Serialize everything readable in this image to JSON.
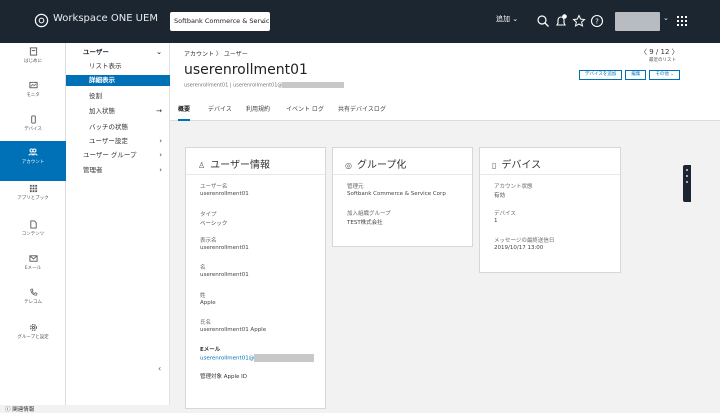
{
  "topbar": {
    "brand": "Workspace ONE UEM",
    "org_selector": "Softbank Commerce & Servic...",
    "add_label": "追加 ⌄"
  },
  "rail": {
    "items": [
      {
        "label": "はじめに",
        "icon": "home-icon"
      },
      {
        "label": "モニタ",
        "icon": "monitor-icon"
      },
      {
        "label": "デバイス",
        "icon": "device-icon"
      },
      {
        "label": "アカウント",
        "icon": "accounts-icon"
      },
      {
        "label": "アプリとブック",
        "icon": "apps-grid-icon"
      },
      {
        "label": "コンテンツ",
        "icon": "content-icon"
      },
      {
        "label": "Eメール",
        "icon": "email-icon"
      },
      {
        "label": "テレコム",
        "icon": "telecom-icon"
      },
      {
        "label": "グループと設定",
        "icon": "gear-icon"
      }
    ],
    "bottom": "関連情報"
  },
  "subnav": {
    "users_head": "ユーザー",
    "list_view": "リスト表示",
    "detail_view": "詳細表示",
    "roles": "役割",
    "enrollment_status": "加入状態",
    "batch_status": "バッチの状態",
    "user_settings": "ユーザー設定",
    "user_groups": "ユーザー グループ",
    "admins": "管理者"
  },
  "header": {
    "breadcrumb": "アカウント  〉 ユーザー",
    "title": "userenrollment01",
    "subtitle": "userenrollment01 | userenrollment01@",
    "pager": "〈   9 / 12   〉",
    "pager_sub": "最近のリスト",
    "btn_add_device": "デバイスを追加",
    "btn_edit": "編集",
    "btn_more": "その他 ⌄"
  },
  "tabs": [
    "概要",
    "デバイス",
    "利用規約",
    "イベント ログ",
    "共有デバイスログ"
  ],
  "user_info": {
    "title": "ユーザー情報",
    "fields": [
      {
        "label": "ユーザー名",
        "value": "userenrollment01"
      },
      {
        "label": "タイプ",
        "value": "ベーシック"
      },
      {
        "label": "表示名",
        "value": "userenrollment01"
      },
      {
        "label": "名",
        "value": "userenrollment01"
      },
      {
        "label": "姓",
        "value": "Apple"
      },
      {
        "label": "氏名",
        "value": "userenrollment01 Apple"
      },
      {
        "label": "Eメール",
        "value": "userenrollment01@"
      }
    ],
    "managed_apple_id": "管理対象 Apple ID"
  },
  "grouping": {
    "title": "グループ化",
    "managed_by_label": "管理元",
    "managed_by_value": "Softbank Commerce & Service Corp",
    "enroll_group_label": "加入組織グループ",
    "enroll_group_value": "TEST株式会社"
  },
  "devices": {
    "title": "デバイス",
    "status_label": "アカウント状態",
    "status_value": "有効",
    "count_label": "デバイス",
    "count_value": "1",
    "last_msg_label": "メッセージの最終送信日",
    "last_msg_value": "2019/10/17 13:00"
  }
}
